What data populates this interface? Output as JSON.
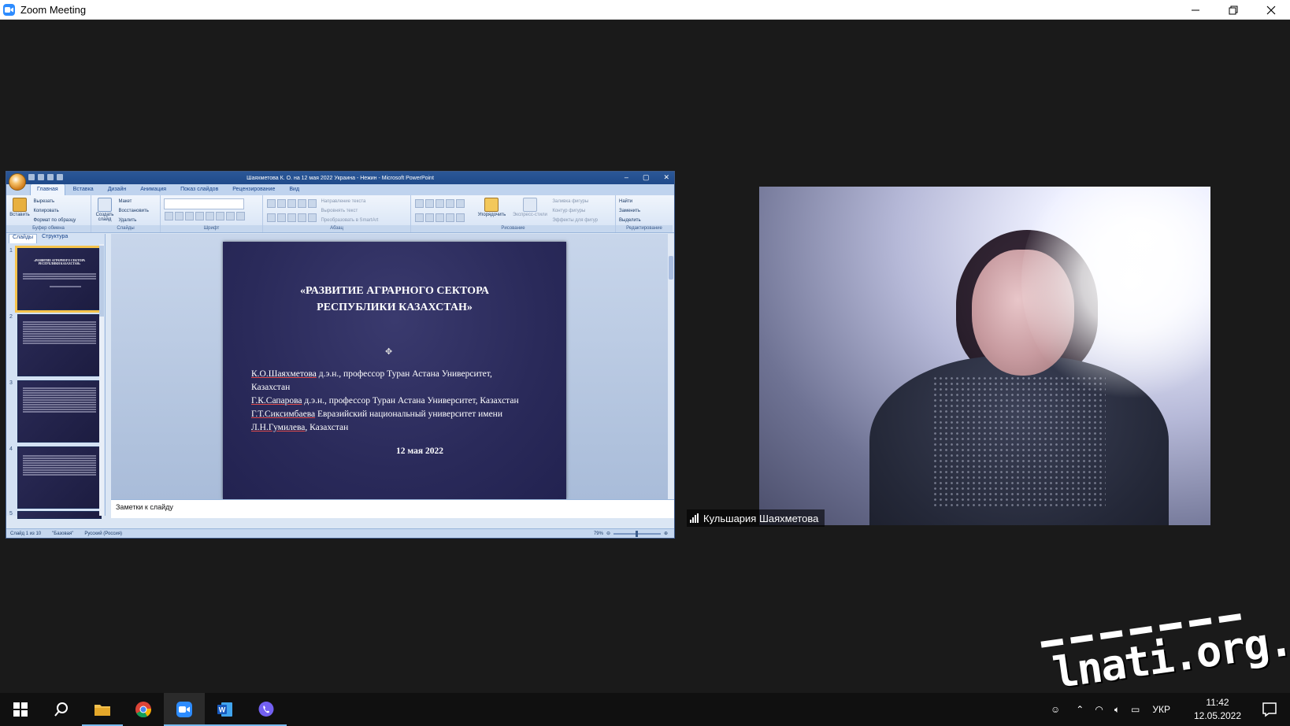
{
  "window": {
    "title": "Zoom Meeting",
    "controls": [
      "minimize",
      "restore",
      "close"
    ]
  },
  "share": {
    "ppt_window_title": "Шаяхметова К. О. на 12 мая 2022 Украина - Нежин - Microsoft PowerPoint",
    "tabs": [
      "Главная",
      "Вставка",
      "Дизайн",
      "Анимация",
      "Показ слайдов",
      "Рецензирование",
      "Вид"
    ],
    "ribbon": {
      "clipboard": {
        "label": "Буфер обмена",
        "paste": "Вставить",
        "cut": "Вырезать",
        "copy": "Копировать",
        "format": "Формат по образцу"
      },
      "slides": {
        "label": "Слайды",
        "create": "Создать слайд",
        "layout": "Макет",
        "restore": "Восстановить",
        "delete": "Удалить"
      },
      "font": {
        "label": "Шрифт"
      },
      "paragraph": {
        "label": "Абзац",
        "text_dir": "Направление текста",
        "align_text": "Выровнять текст",
        "smartart": "Преобразовать в SmartArt"
      },
      "drawing": {
        "label": "Рисование",
        "arrange": "Упорядочить",
        "styles": "Экспресс-стили",
        "fill": "Заливка фигуры",
        "outline": "Контур фигуры",
        "effects": "Эффекты для фигур"
      },
      "editing": {
        "label": "Редактирование",
        "find": "Найти",
        "replace": "Заменить",
        "select": "Выделить"
      }
    },
    "side_tabs": [
      "Слайды",
      "Структура"
    ],
    "thumbnails": [
      "1",
      "2",
      "3",
      "4",
      "5"
    ],
    "slide": {
      "title_line1": "«РАЗВИТИЕ АГРАРНОГО СЕКТОРА",
      "title_line2": "РЕСПУБЛИКИ КАЗАХСТАН»",
      "author1_name": "К.О.Шаяхметова",
      "author1_rest": "  д.э.н., профессор Туран Астана  Университет,",
      "author1_country": "Казахстан",
      "author2_name": "Г.К.Сапарова",
      "author2_rest": " д.э.н., профессор Туран Астана  Университет,  Казахстан",
      "author3_name": "Г.Т.Сиксимбаева",
      "author3_rest": "  Евразийский национальный университет имени",
      "author4_name": "Л.Н.Гумилева",
      "author4_rest": ", Казахстан",
      "date": "12 мая 2022"
    },
    "notes_placeholder": "Заметки к слайду",
    "status": {
      "slide_count": "Слайд 1 из 10",
      "theme": "\"Базовая\"",
      "language": "Русский (Россия)",
      "zoom": "79%"
    }
  },
  "participant": {
    "name": "Кульшария Шаяхметова"
  },
  "watermark": {
    "text": "lnati.org.ua"
  },
  "taskbar": {
    "apps": [
      "windows-start",
      "search",
      "file-explorer",
      "chrome",
      "zoom",
      "word",
      "viber"
    ],
    "active_app": "zoom",
    "tray": {
      "language": "УКР",
      "time": "11:42",
      "date": "12.05.2022"
    }
  }
}
